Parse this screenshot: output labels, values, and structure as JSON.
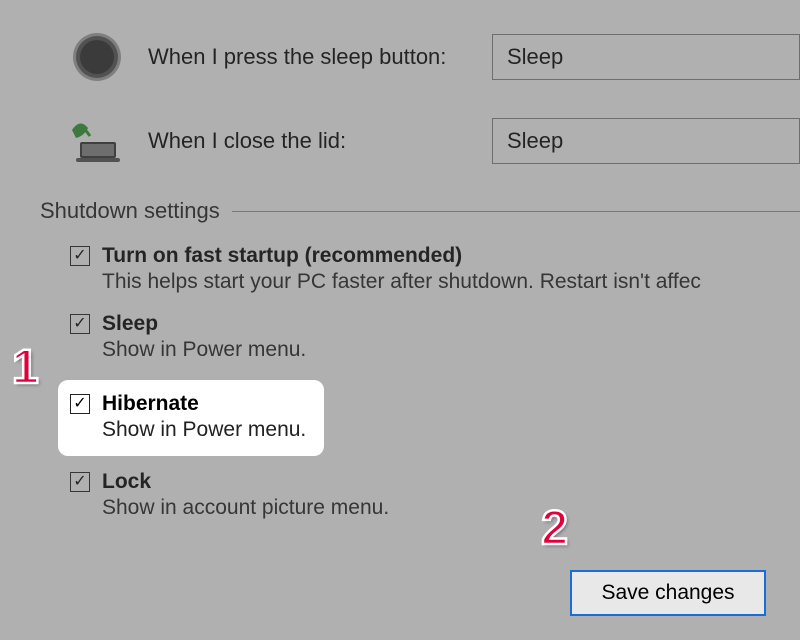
{
  "options": {
    "sleep_button": {
      "label": "When I press the sleep button:",
      "value": "Sleep"
    },
    "close_lid": {
      "label": "When I close the lid:",
      "value": "Sleep"
    }
  },
  "section_title": "Shutdown settings",
  "shutdown_items": {
    "fast_startup": {
      "title": "Turn on fast startup (recommended)",
      "desc": "This helps start your PC faster after shutdown. Restart isn't affec",
      "checked": true
    },
    "sleep": {
      "title": "Sleep",
      "desc": "Show in Power menu.",
      "checked": true
    },
    "hibernate": {
      "title": "Hibernate",
      "desc": "Show in Power menu.",
      "checked": true
    },
    "lock": {
      "title": "Lock",
      "desc": "Show in account picture menu.",
      "checked": true
    }
  },
  "save_button_label": "Save changes",
  "annotations": {
    "one": "1",
    "two": "2"
  },
  "checkmark": "✓"
}
